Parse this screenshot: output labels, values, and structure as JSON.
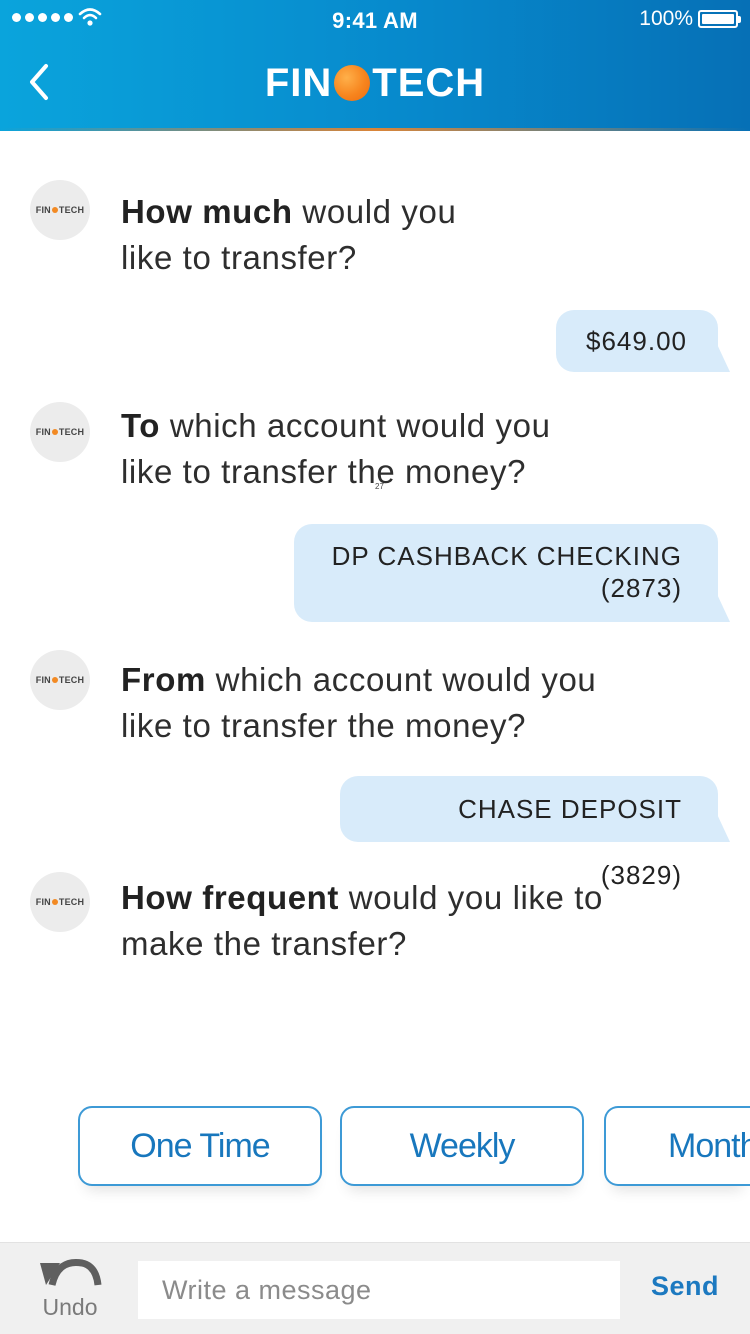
{
  "status_bar": {
    "time": "9:41 AM",
    "battery": "100%",
    "signal_icon": "signal-dots-icon",
    "wifi_icon": "wifi-icon",
    "battery_icon": "battery-icon"
  },
  "header": {
    "back_icon": "chevron-left-icon",
    "brand_left": "FIN",
    "brand_right": "TECH",
    "brand_color": "#0789cc",
    "brand_dot_color": "#f7851e"
  },
  "avatar": {
    "left": "FIN",
    "right": "TECH"
  },
  "chat": {
    "messages": [
      {
        "bold": "How much",
        "rest": " would you",
        "line2": "like to transfer?"
      },
      {
        "bold": "To",
        "rest": " which account would you",
        "line2": "like to transfer the money?"
      },
      {
        "bold": "From",
        "rest": " which account would you",
        "line2": "like to transfer the money?"
      },
      {
        "bold": "How frequent",
        "rest": " would you like to",
        "line2": "make the transfer?"
      }
    ],
    "replies": [
      {
        "line1": "$649.00"
      },
      {
        "line1": "DP CASHBACK CHECKING",
        "line2": "(2873)"
      },
      {
        "line1": "CHASE DEPOSIT (3829)"
      }
    ],
    "stray_text": "27",
    "bubble_color": "#d8ebfa"
  },
  "quick_replies": [
    "One Time",
    "Weekly",
    "Monthly"
  ],
  "input_bar": {
    "undo_label": "Undo",
    "undo_icon": "undo-icon",
    "placeholder": "Write a message",
    "send_label": "Send",
    "accent": "#1c79c0"
  }
}
